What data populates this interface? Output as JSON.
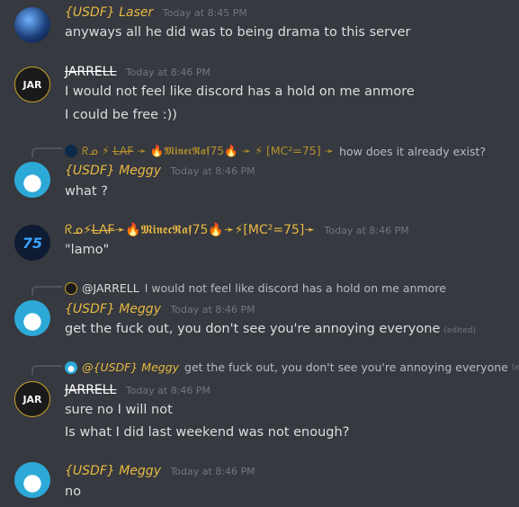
{
  "messages": [
    {
      "author": "{USDF} Laser",
      "timestamp": "Today at 8:45 PM",
      "lines": [
        "anyways all he did was to being drama to this server"
      ]
    },
    {
      "author": "JARRELL",
      "timestamp": "Today at 8:46 PM",
      "lines": [
        "I would not feel like discord has a hold on me anmore",
        "I could be free :))"
      ]
    },
    {
      "reply_author": "ᖇᓄ ⚡ L̶A̶F̶ ➛ 🔥𝕸𝖎𝖓𝖊𝖈𝕽𝖆𝖋75🔥 ➛ ⚡ [MC²=75] ➛",
      "reply_text": "how does it already exist?",
      "author": "{USDF} Meggy",
      "timestamp": "Today at 8:46 PM",
      "lines": [
        "what ?"
      ]
    },
    {
      "author": "ᖇᓄ⚡L̶A̶F̶➛🔥𝕸𝖎𝖓𝖊𝖈𝕽𝖆𝖋75🔥➛⚡[MC²=75]➛",
      "timestamp": "Today at 8:46 PM",
      "lines": [
        "\"lamo\""
      ]
    },
    {
      "reply_author": "@JARRELL",
      "reply_text": "I would not feel like discord has a hold on me anmore",
      "author": "{USDF} Meggy",
      "timestamp": "Today at 8:46 PM",
      "lines": [
        "get the fuck out, you don't see you're annoying everyone"
      ],
      "edited": "(edited)"
    },
    {
      "reply_author": "@{USDF} Meggy",
      "reply_text": "get the fuck out, you don't see you're annoying everyone",
      "reply_edited": "(edited)",
      "author": "JARRELL",
      "timestamp": "Today at 8:46 PM",
      "lines": [
        "sure no I will not",
        "Is what I did last weekend was not enough?"
      ]
    },
    {
      "author": "{USDF} Meggy",
      "timestamp": "Today at 8:46 PM",
      "lines": [
        "no"
      ]
    }
  ],
  "avatar_labels": {
    "jarrell": "JAR",
    "laf": "75"
  },
  "colors": {
    "background": "#36393f",
    "usdf_name": "#e8b844",
    "timestamp": "#72767d",
    "text": "#dcddde"
  }
}
